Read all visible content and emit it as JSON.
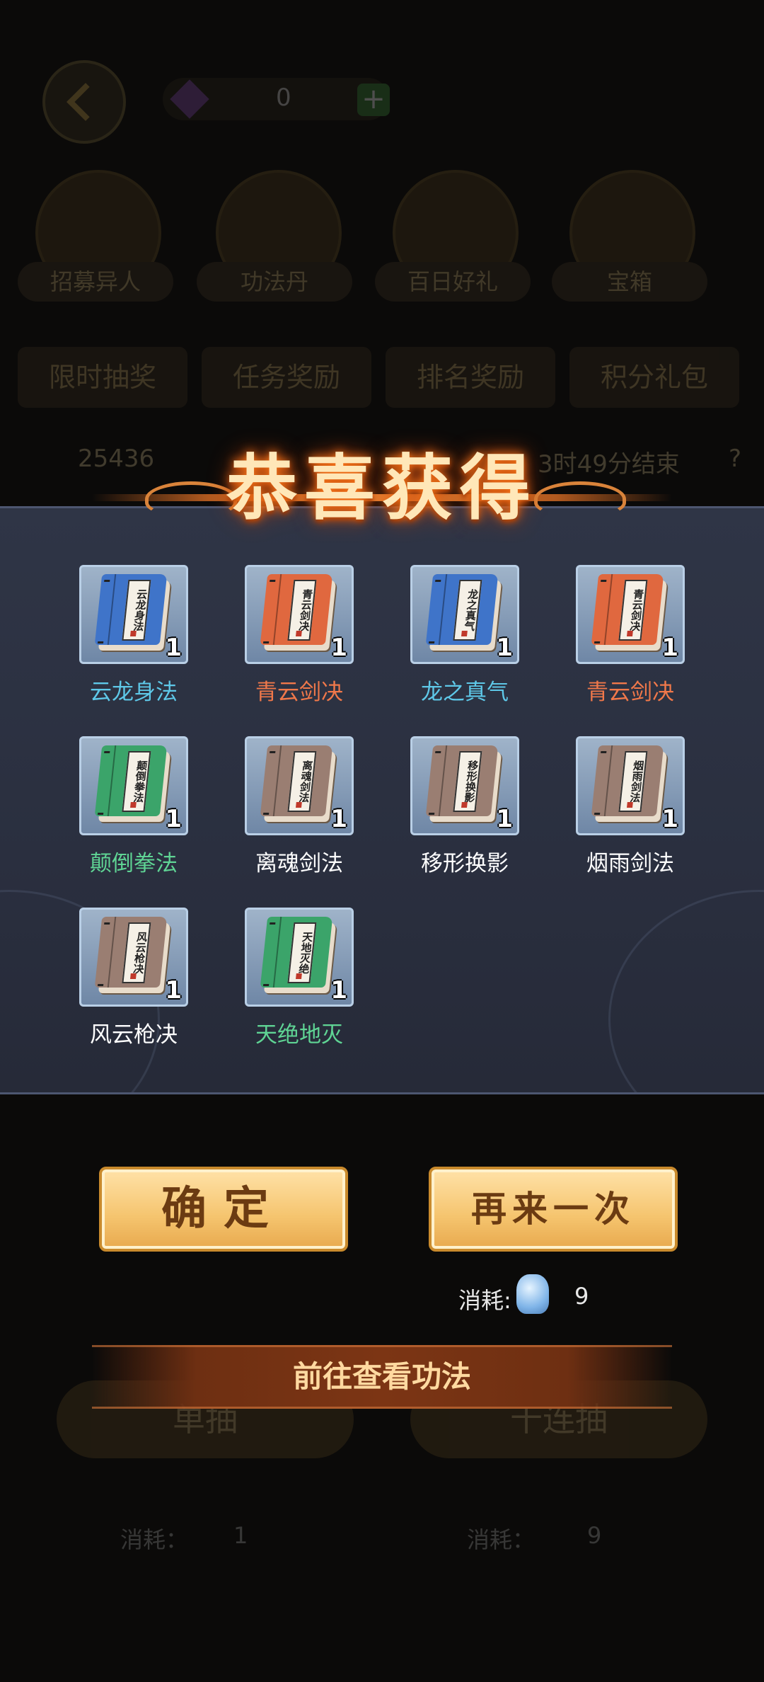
{
  "background": {
    "currency_value": "0",
    "plus_label": "+",
    "module_labels": [
      "招募异人",
      "功法丹",
      "百日好礼",
      "宝箱"
    ],
    "tabs": [
      "限时抽奖",
      "任务奖励",
      "排名奖励",
      "积分礼包"
    ],
    "stats": [
      "25436",
      "3时49分结束",
      "?"
    ],
    "big_buttons": [
      "单抽",
      "十连抽"
    ],
    "cost_items": [
      "消耗：",
      "1",
      "消耗：",
      "9"
    ]
  },
  "title": "恭喜获得",
  "rewards": [
    {
      "name": "云龙身法",
      "book_title": "云龙身法",
      "qty": "1",
      "cover_color": "#3f74c9",
      "name_color": "#5ec8e8"
    },
    {
      "name": "青云剑决",
      "book_title": "青云剑决",
      "qty": "1",
      "cover_color": "#e0683f",
      "name_color": "#f0784a"
    },
    {
      "name": "龙之真气",
      "book_title": "龙之真气",
      "qty": "1",
      "cover_color": "#3f74c9",
      "name_color": "#5ec8e8"
    },
    {
      "name": "青云剑决",
      "book_title": "青云剑决",
      "qty": "1",
      "cover_color": "#e0683f",
      "name_color": "#f0784a"
    },
    {
      "name": "颠倒拳法",
      "book_title": "颠倒拳法",
      "qty": "1",
      "cover_color": "#3ba46a",
      "name_color": "#5fd494"
    },
    {
      "name": "离魂剑法",
      "book_title": "离魂剑法",
      "qty": "1",
      "cover_color": "#9a7e72",
      "name_color": "#ffffff"
    },
    {
      "name": "移形换影",
      "book_title": "移形换影",
      "qty": "1",
      "cover_color": "#9a7e72",
      "name_color": "#ffffff"
    },
    {
      "name": "烟雨剑法",
      "book_title": "烟雨剑法",
      "qty": "1",
      "cover_color": "#9a7e72",
      "name_color": "#ffffff"
    },
    {
      "name": "风云枪决",
      "book_title": "风云枪决",
      "qty": "1",
      "cover_color": "#9a7e72",
      "name_color": "#ffffff"
    },
    {
      "name": "天绝地灭",
      "book_title": "天地灭绝",
      "qty": "1",
      "cover_color": "#3ba46a",
      "name_color": "#5fd494"
    }
  ],
  "buttons": {
    "confirm_label": "确定",
    "again_label": "再来一次"
  },
  "cost": {
    "label": "消耗:",
    "icon": "spirit-token-icon",
    "value": "9"
  },
  "goto_label": "前往查看功法"
}
